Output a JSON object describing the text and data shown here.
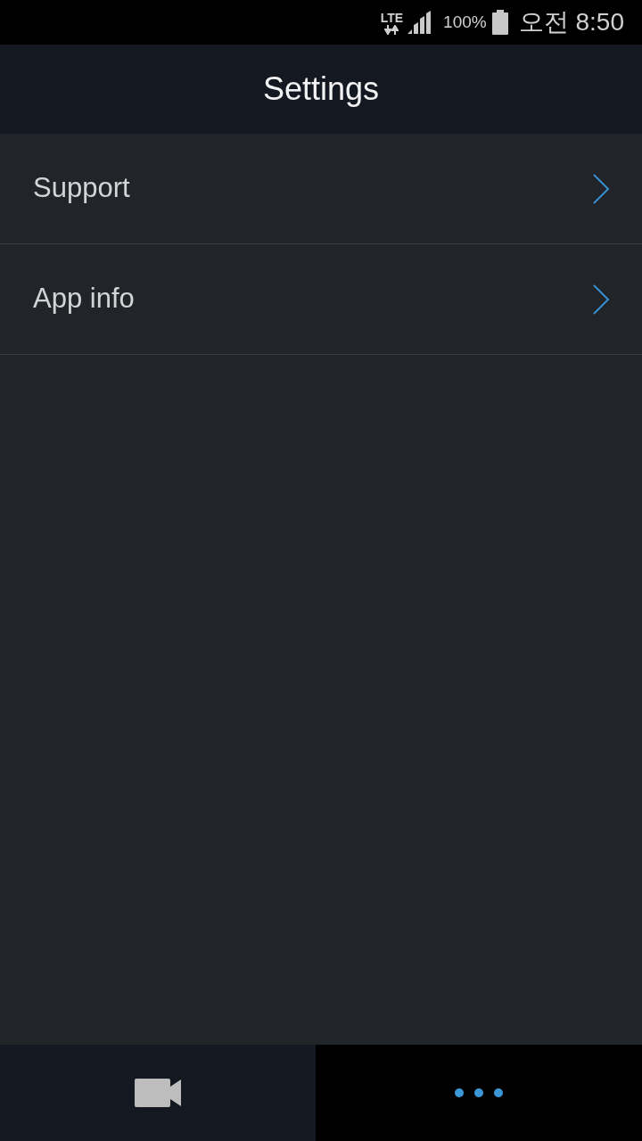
{
  "status_bar": {
    "network": "LTE",
    "battery": "100%",
    "time": "오전 8:50"
  },
  "header": {
    "title": "Settings"
  },
  "items": [
    {
      "label": "Support"
    },
    {
      "label": "App info"
    }
  ],
  "bottom_tabs": [
    {
      "kind": "camera",
      "selected": false
    },
    {
      "kind": "more",
      "selected": true
    }
  ]
}
